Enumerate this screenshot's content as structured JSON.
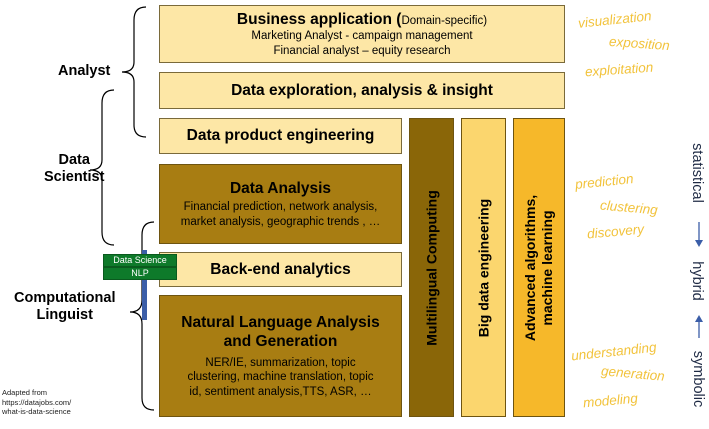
{
  "roles": {
    "analyst": "Analyst",
    "data_scientist_line1": "Data",
    "data_scientist_line2": "Scientist",
    "comp_ling_line1": "Computational",
    "comp_ling_line2": "Linguist"
  },
  "boxes": {
    "business": {
      "title": "Business application (",
      "domain": "Domain-specific)",
      "line1": "Marketing Analyst -  campaign management",
      "line2": "Financial analyst – equity research"
    },
    "exploration": {
      "title": "Data exploration, analysis & insight"
    },
    "product": {
      "title": "Data product engineering"
    },
    "analysis": {
      "title": "Data Analysis",
      "line1": "Financial prediction, network analysis,",
      "line2": "market analysis, geographic trends , …"
    },
    "backend": {
      "title": "Back-end analytics"
    },
    "nlp": {
      "title_line1": "Natural Language Analysis",
      "title_line2": "and Generation",
      "line1": "NER/IE, summarization, topic",
      "line2": "clustering, machine translation, topic",
      "line3": "id, sentiment analysis,TTS, ASR, …"
    }
  },
  "columns": {
    "multilingual": "Multilingual Computing",
    "bigdata": "Big data engineering",
    "algorithms_line1": "Advanced algorithms,",
    "algorithms_line2": "machine learning"
  },
  "sign": {
    "top": "Data Science",
    "bottom": "NLP"
  },
  "keywords": {
    "visualization": "visualization",
    "exposition": "exposition",
    "exploitation": "exploitation",
    "prediction": "prediction",
    "clustering": "clustering",
    "discovery": "discovery",
    "understanding": "understanding",
    "generation": "generation",
    "modeling": "modeling"
  },
  "scale": {
    "statistical": "statistical",
    "hybrid": "hybrid",
    "symbolic": "symbolic"
  },
  "credit": {
    "line1": "Adapted from",
    "line2": "https://datajobs.com/",
    "line3": "what-is-data-science"
  },
  "colors": {
    "light_box": "#fde7a6",
    "dark_box": "#a87d12",
    "multilingual_col": "#8a6608",
    "bigdata_col": "#fbd66e",
    "algorithms_col": "#f6b82a",
    "keyword": "#f2c33c",
    "scale_text": "#1e2a44"
  }
}
